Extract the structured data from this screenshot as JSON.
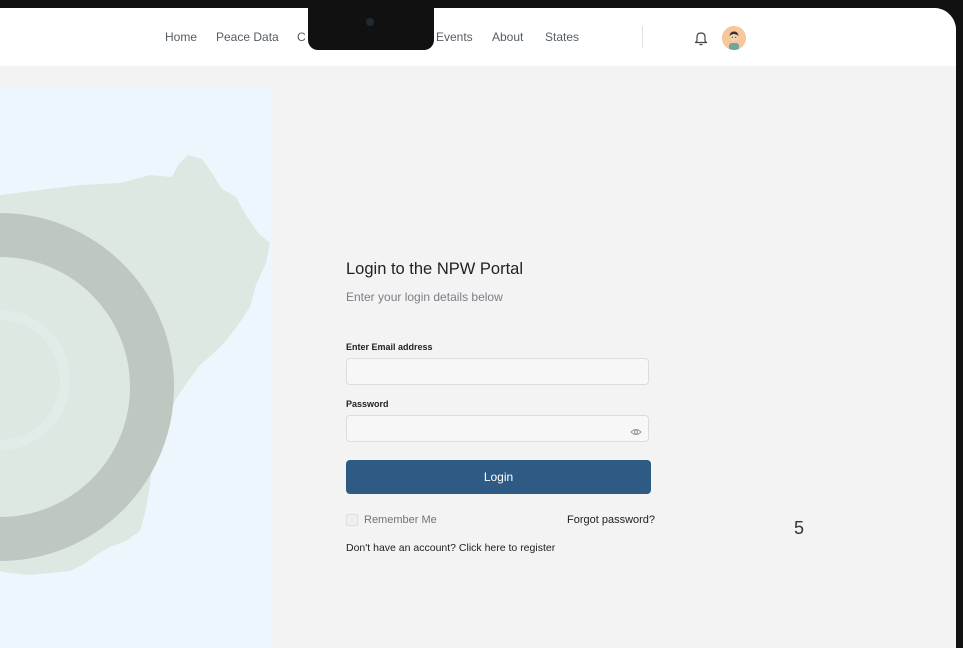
{
  "nav": {
    "items": [
      "Home",
      "Peace Data",
      "C",
      "Events",
      "About",
      "States"
    ]
  },
  "header": {
    "bell_icon": "bell-icon",
    "avatar": "user-avatar"
  },
  "login": {
    "title": "Login to the NPW Portal",
    "subtitle": "Enter your login details below",
    "email_label": "Enter Email address",
    "email_value": "",
    "password_label": "Password",
    "password_value": "",
    "password_toggle_icon": "eye-icon",
    "login_button": "Login",
    "remember_me": "Remember Me",
    "forgot_password": "Forgot password?",
    "register_link": "Don't have an account? Click here to register"
  },
  "page_number": "5",
  "colors": {
    "primary": "#2e5a84",
    "panel_bg": "#eef6fd",
    "map_fill": "#dde8e2",
    "emblem": "#bfc7c1"
  }
}
